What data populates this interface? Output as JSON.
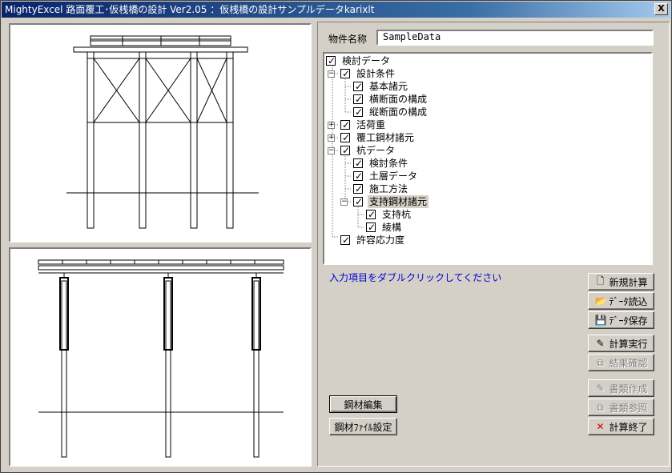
{
  "window": {
    "title": "MightyExcel 路面覆工･仮桟橋の設計 Ver2.05 ：仮桟橋の設計サンプルデータkarixlt",
    "close_label": "X"
  },
  "project": {
    "label": "物件名称",
    "value": "SampleData"
  },
  "tree": [
    {
      "label": "検討データ",
      "level": 0,
      "expander": "none",
      "checked": true
    },
    {
      "label": "設計条件",
      "level": 1,
      "expander": "minus",
      "checked": true
    },
    {
      "label": "基本諸元",
      "level": 2,
      "expander": "none",
      "checked": true
    },
    {
      "label": "横断面の構成",
      "level": 2,
      "expander": "none",
      "checked": true
    },
    {
      "label": "縦断面の構成",
      "level": 2,
      "expander": "none",
      "checked": true
    },
    {
      "label": "活荷重",
      "level": 1,
      "expander": "plus",
      "checked": true
    },
    {
      "label": "覆工鋼材諸元",
      "level": 1,
      "expander": "plus",
      "checked": true
    },
    {
      "label": "杭データ",
      "level": 1,
      "expander": "minus",
      "checked": true
    },
    {
      "label": "検討条件",
      "level": 2,
      "expander": "none",
      "checked": true
    },
    {
      "label": "土層データ",
      "level": 2,
      "expander": "none",
      "checked": true
    },
    {
      "label": "施工方法",
      "level": 2,
      "expander": "none",
      "checked": true
    },
    {
      "label": "支持鋼材諸元",
      "level": 2,
      "expander": "minus",
      "checked": true,
      "selected": true
    },
    {
      "label": "支持杭",
      "level": 3,
      "expander": "none",
      "checked": true
    },
    {
      "label": "綾構",
      "level": 3,
      "expander": "none",
      "checked": true
    },
    {
      "label": "許容応力度",
      "level": 1,
      "expander": "none",
      "checked": true
    }
  ],
  "hint": "入力項目をダブルクリックしてください",
  "buttons": {
    "new_calc": "新規計算",
    "load_data": "ﾃﾞｰﾀ読込",
    "save_data": "ﾃﾞｰﾀ保存",
    "run_calc": "計算実行",
    "check_results": "結果確認",
    "create_docs": "書類作成",
    "view_docs": "書類参照",
    "exit_calc": "計算終了",
    "edit_steel": "鋼材編集",
    "steel_file_settings": "鋼材ﾌｧｲﾙ設定"
  },
  "icons": {
    "new_calc": "document-icon",
    "load_data": "folder-open-icon",
    "save_data": "floppy-disk-icon",
    "run_calc": "calculator-icon",
    "check_results": "copy-icon",
    "create_docs": "edit-doc-icon",
    "view_docs": "copy-icon",
    "exit_calc": "close-icon"
  },
  "colors": {
    "hint": "#0000d0",
    "title_start": "#0a246a",
    "title_end": "#a6caf0",
    "exit_icon": "#d00000"
  },
  "disabled_buttons": [
    "check_results",
    "create_docs",
    "view_docs"
  ]
}
